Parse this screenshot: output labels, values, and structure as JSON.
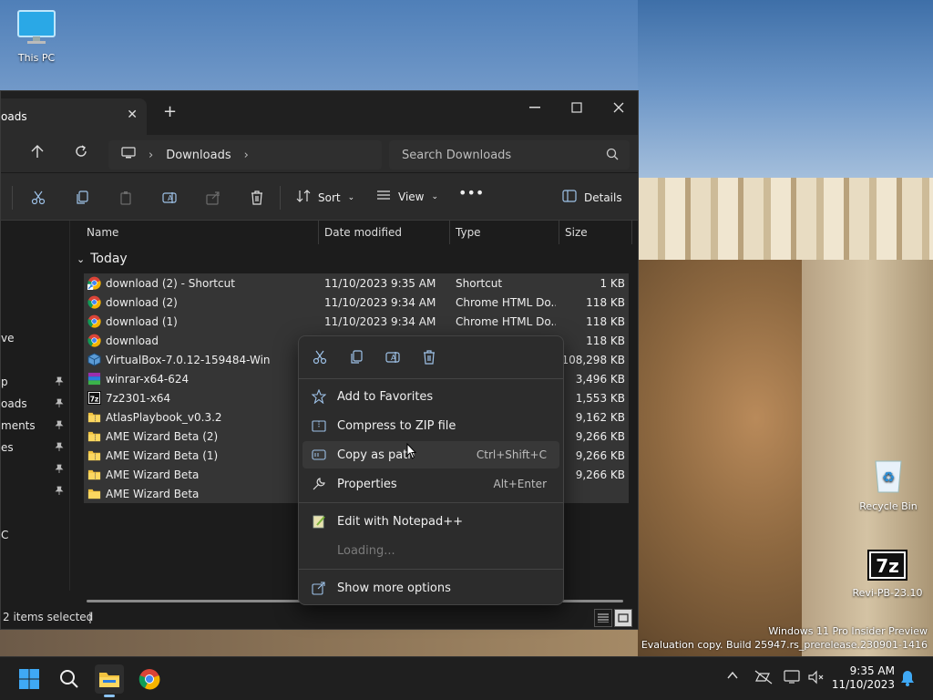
{
  "desktop": {
    "icons": [
      {
        "label": "This PC",
        "icon": "monitor-icon"
      },
      {
        "label": "Recycle Bin",
        "icon": "recycle-bin-icon"
      },
      {
        "label": "Revi-PB-23.10",
        "icon": "7zip-archive-icon"
      }
    ],
    "watermark": {
      "line1": "Windows 11 Pro Insider Preview",
      "line2": "Evaluation copy. Build 25947.rs_prerelease.230901-1416"
    }
  },
  "explorer": {
    "tab_title": "oads",
    "address": {
      "crumb": "Downloads"
    },
    "search": {
      "placeholder": "Search Downloads"
    },
    "toolbar": {
      "sort_label": "Sort",
      "view_label": "View",
      "details_label": "Details"
    },
    "nav_pane": [
      {
        "label": "ve",
        "pinned": false
      },
      {
        "label": "p",
        "pinned": true
      },
      {
        "label": "oads",
        "pinned": true
      },
      {
        "label": "ments",
        "pinned": true
      },
      {
        "label": "es",
        "pinned": true
      },
      {
        "label": "",
        "pinned": true
      },
      {
        "label": "",
        "pinned": true
      },
      {
        "label": "C",
        "pinned": false
      }
    ],
    "columns": {
      "name": "Name",
      "date": "Date modified",
      "type": "Type",
      "size": "Size"
    },
    "group": "Today",
    "files": [
      {
        "name": "download (2) - Shortcut",
        "date": "11/10/2023 9:35 AM",
        "type": "Shortcut",
        "size": "1 KB",
        "icon": "chrome-shortcut-icon"
      },
      {
        "name": "download (2)",
        "date": "11/10/2023 9:34 AM",
        "type": "Chrome HTML Do...",
        "size": "118 KB",
        "icon": "chrome-icon"
      },
      {
        "name": "download (1)",
        "date": "11/10/2023 9:34 AM",
        "type": "Chrome HTML Do...",
        "size": "118 KB",
        "icon": "chrome-icon"
      },
      {
        "name": "download",
        "date": "",
        "type": "",
        "size": "118 KB",
        "icon": "chrome-icon"
      },
      {
        "name": "VirtualBox-7.0.12-159484-Win",
        "date": "",
        "type": "",
        "size": "108,298 KB",
        "icon": "virtualbox-icon"
      },
      {
        "name": "winrar-x64-624",
        "date": "",
        "type": "",
        "size": "3,496 KB",
        "icon": "winrar-icon"
      },
      {
        "name": "7z2301-x64",
        "date": "",
        "type": "",
        "size": "1,553 KB",
        "icon": "7zip-icon"
      },
      {
        "name": "AtlasPlaybook_v0.3.2",
        "date": "",
        "type": "",
        "size": "9,162 KB",
        "icon": "zip-folder-icon"
      },
      {
        "name": "AME Wizard Beta (2)",
        "date": "",
        "type": "",
        "size": "9,266 KB",
        "icon": "zip-folder-icon"
      },
      {
        "name": "AME Wizard Beta (1)",
        "date": "",
        "type": "",
        "size": "9,266 KB",
        "icon": "zip-folder-icon"
      },
      {
        "name": "AME Wizard Beta",
        "date": "",
        "type": "",
        "size": "9,266 KB",
        "icon": "zip-folder-icon"
      },
      {
        "name": "AME Wizard Beta",
        "date": "",
        "type": "",
        "size": "",
        "icon": "folder-icon"
      }
    ],
    "status": "2 items selected"
  },
  "context_menu": {
    "items": [
      {
        "label": "Add to Favorites",
        "shortcut": "",
        "icon": "star-icon"
      },
      {
        "label": "Compress to ZIP file",
        "shortcut": "",
        "icon": "zip-icon"
      },
      {
        "label": "Copy as path",
        "shortcut": "Ctrl+Shift+C",
        "icon": "copy-path-icon"
      },
      {
        "label": "Properties",
        "shortcut": "Alt+Enter",
        "icon": "wrench-icon"
      },
      {
        "label": "Edit with Notepad++",
        "shortcut": "",
        "icon": "notepadpp-icon"
      },
      {
        "label": "Loading...",
        "shortcut": "",
        "icon": ""
      },
      {
        "label": "Show more options",
        "shortcut": "",
        "icon": "share-icon"
      }
    ]
  },
  "taskbar": {
    "time": "9:35 AM",
    "date": "11/10/2023"
  }
}
